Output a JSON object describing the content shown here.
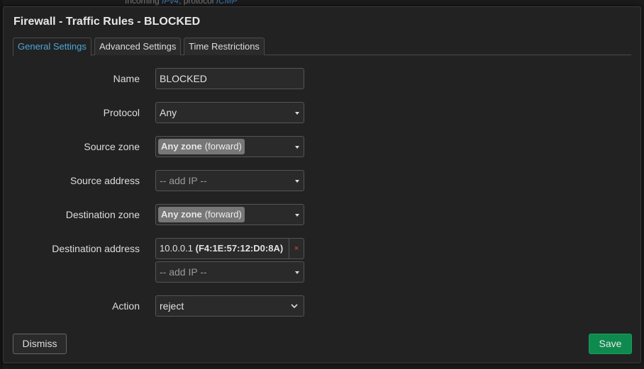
{
  "background": {
    "peek_text": "Incoming",
    "peek_link1": "IPv4",
    "peek_mid": ", protocol",
    "peek_link2": "ICMP"
  },
  "modal": {
    "title": "Firewall - Traffic Rules - BLOCKED",
    "tabs": [
      {
        "label": "General Settings",
        "active": true
      },
      {
        "label": "Advanced Settings",
        "active": false
      },
      {
        "label": "Time Restrictions",
        "active": false
      }
    ]
  },
  "form": {
    "name": {
      "label": "Name",
      "value": "BLOCKED"
    },
    "protocol": {
      "label": "Protocol",
      "value": "Any"
    },
    "source_zone": {
      "label": "Source zone",
      "zone": "Any zone",
      "direction": "(forward)"
    },
    "source_address": {
      "label": "Source address",
      "placeholder": "-- add IP --"
    },
    "destination_zone": {
      "label": "Destination zone",
      "zone": "Any zone",
      "direction": "(forward)"
    },
    "destination_address": {
      "label": "Destination address",
      "entry_ip": "10.0.0.1",
      "entry_mac": "(F4:1E:57:12:D0:8A)",
      "remove_symbol": "×",
      "placeholder": "-- add IP --"
    },
    "action": {
      "label": "Action",
      "value": "reject"
    }
  },
  "buttons": {
    "dismiss": "Dismiss",
    "save": "Save"
  },
  "colors": {
    "accent_tab": "#4ea7d6",
    "save": "#0f8a4f",
    "remove": "#e04444"
  }
}
